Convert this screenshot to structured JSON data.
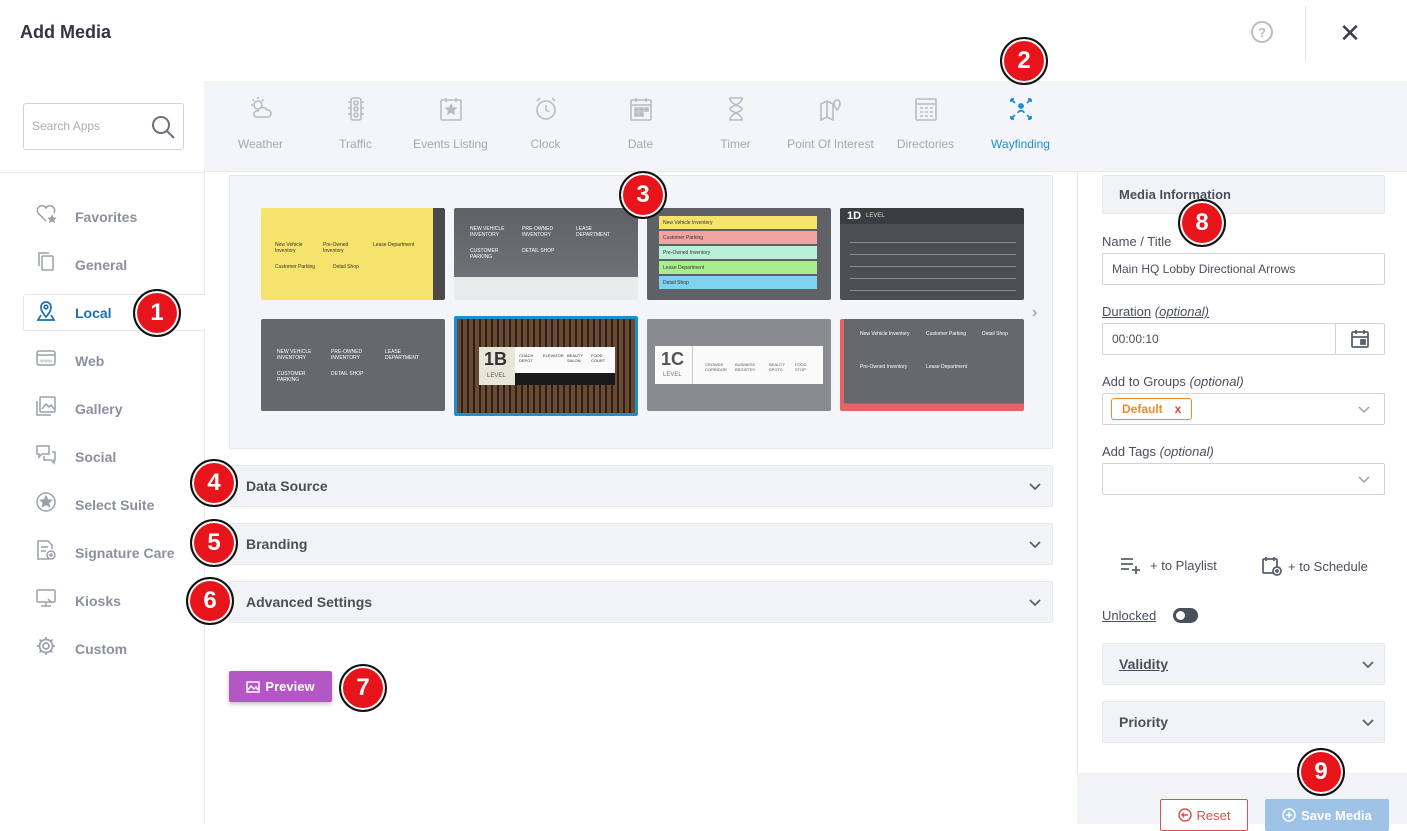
{
  "header": {
    "title": "Add Media",
    "help_glyph": "?",
    "close_glyph": "✕"
  },
  "search": {
    "placeholder": "Search Apps"
  },
  "sidebar": {
    "items": [
      {
        "label": "Favorites",
        "icon": "heart-star-icon"
      },
      {
        "label": "General",
        "icon": "copy-icon"
      },
      {
        "label": "Local",
        "icon": "location-pin-icon",
        "active": true
      },
      {
        "label": "Web",
        "icon": "www-icon"
      },
      {
        "label": "Gallery",
        "icon": "gallery-icon"
      },
      {
        "label": "Social",
        "icon": "chat-icon"
      },
      {
        "label": "Select Suite",
        "icon": "star-circle-icon"
      },
      {
        "label": "Signature Care",
        "icon": "care-doc-icon"
      },
      {
        "label": "Kiosks",
        "icon": "kiosk-icon"
      },
      {
        "label": "Custom",
        "icon": "gear-icon"
      }
    ]
  },
  "apps": [
    {
      "label": "Weather",
      "icon": "weather-icon"
    },
    {
      "label": "Traffic",
      "icon": "traffic-light-icon"
    },
    {
      "label": "Events Listing",
      "icon": "calendar-star-icon"
    },
    {
      "label": "Clock",
      "icon": "alarm-clock-icon"
    },
    {
      "label": "Date",
      "icon": "calendar-icon"
    },
    {
      "label": "Timer",
      "icon": "hourglass-icon"
    },
    {
      "label": "Point Of Interest",
      "icon": "map-pin-icon"
    },
    {
      "label": "Directories",
      "icon": "directory-icon"
    },
    {
      "label": "Wayfinding",
      "icon": "wayfinding-icon",
      "active": true
    }
  ],
  "templates": {
    "t1": [
      "New Vehicle Inventory",
      "Pre-Owned Inventory",
      "Lease Department",
      "Customer Parking",
      "Detail Shop"
    ],
    "t2": [
      "NEW VEHICLE INVENTORY",
      "PRE-OWNED INVENTORY",
      "LEASE DEPARTMENT",
      "CUSTOMER PARKING",
      "DETAIL SHOP"
    ],
    "t3": [
      "New Vehicle Inventory",
      "Customer Parking",
      "Pre-Owned Inventory",
      "Lease Department",
      "Detail Shop"
    ],
    "t4_title": "1D",
    "t4_sub": "LEVEL",
    "t5": [
      "NEW VEHICLE INVENTORY",
      "PRE-OWNED INVENTORY",
      "LEASE DEPARTMENT",
      "CUSTOMER PARKING",
      "DETAIL SHOP"
    ],
    "t6_title": "1B",
    "t6_sub": "LEVEL",
    "t6_cols": [
      "COACH DEPOT",
      "ELEVATOR",
      "BEAUTY SALON",
      "FOOD COURT"
    ],
    "t7_title": "1C",
    "t7_sub": "LEVEL",
    "t7_cols": [
      "CROWDS CORRIDOR",
      "BUSINESS REGISTRY",
      "BEAUTY SPOTS",
      "FOOD STOP"
    ],
    "t8": [
      "New Vehicle Inventory",
      "Customer Parking",
      "Detail Shop",
      "Pre-Owned Inventory",
      "Lease Department"
    ]
  },
  "accordions": [
    {
      "label": "Data Source"
    },
    {
      "label": "Branding"
    },
    {
      "label": "Advanced Settings"
    }
  ],
  "preview_label": "Preview",
  "right_panel": {
    "heading": "Media Information",
    "name_label": "Name / Title",
    "name_value": "Main HQ Lobby Directional Arrows",
    "duration_label": "Duration",
    "duration_optional": "(optional)",
    "duration_value": "00:00:10",
    "groups_label": "Add to Groups",
    "groups_optional": "(optional)",
    "group_tag": "Default",
    "tags_label": "Add Tags",
    "tags_optional": "(optional)",
    "to_playlist": "+ to Playlist",
    "to_schedule": "+ to Schedule",
    "unlocked_label": "Unlocked",
    "validity_label": "Validity",
    "priority_label": "Priority",
    "reset_label": "Reset",
    "save_label": "Save Media"
  },
  "callouts": [
    "1",
    "2",
    "3",
    "4",
    "5",
    "6",
    "7",
    "8",
    "9"
  ],
  "colors": {
    "accent": "#1c8fd1",
    "callout": "#e8141b",
    "preview": "#b257c4",
    "reset": "#d9534f",
    "save": "#9ec3e6",
    "tag": "#f08a2a"
  }
}
